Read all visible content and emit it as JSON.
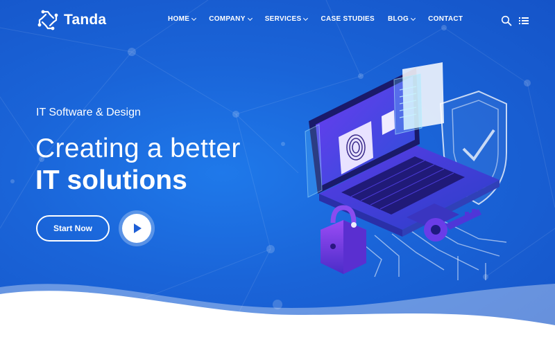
{
  "brand": {
    "name": "Tanda",
    "logo_icon": "circuit-chip-icon"
  },
  "nav": {
    "items": [
      {
        "label": "HOME",
        "has_dropdown": true
      },
      {
        "label": "COMPANY",
        "has_dropdown": true
      },
      {
        "label": "SERVICES",
        "has_dropdown": true
      },
      {
        "label": "CASE STUDIES",
        "has_dropdown": false
      },
      {
        "label": "BLOG",
        "has_dropdown": true
      },
      {
        "label": "CONTACT",
        "has_dropdown": false
      }
    ],
    "icons": [
      "search-icon",
      "menu-icon"
    ]
  },
  "hero": {
    "eyebrow": "IT Software & Design",
    "headline_line1": "Creating a better",
    "headline_line2": "IT solutions",
    "cta_label": "Start Now",
    "video_icon": "play-icon"
  },
  "colors": {
    "background": "#1a64d8",
    "accent_purple": "#7b3cf0",
    "play_arrow": "#1e5fd6",
    "wave": "#ffffff"
  }
}
